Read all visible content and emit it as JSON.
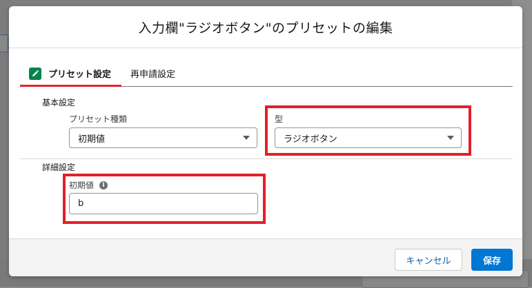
{
  "modal": {
    "title": "入力欄\"ラジオボタン\"のプリセットの編集"
  },
  "tabs": [
    {
      "label": "プリセット設定",
      "icon": "pencil-icon",
      "active": true
    },
    {
      "label": "再申請設定",
      "active": false
    }
  ],
  "basic_settings": {
    "section_label": "基本設定",
    "preset_type": {
      "label": "プリセット種類",
      "value": "初期値"
    },
    "type": {
      "label": "型",
      "value": "ラジオボタン"
    }
  },
  "detail_settings": {
    "section_label": "詳細設定",
    "initial_value": {
      "label": "初期値",
      "value": "b",
      "info_icon": "info-icon"
    }
  },
  "footer": {
    "cancel_label": "キャンセル",
    "save_label": "保存"
  },
  "colors": {
    "accent": "#0176d3",
    "highlight": "#e41e26",
    "tab_active_underline": "#e0262c",
    "tab_icon_bg": "#04844b"
  }
}
